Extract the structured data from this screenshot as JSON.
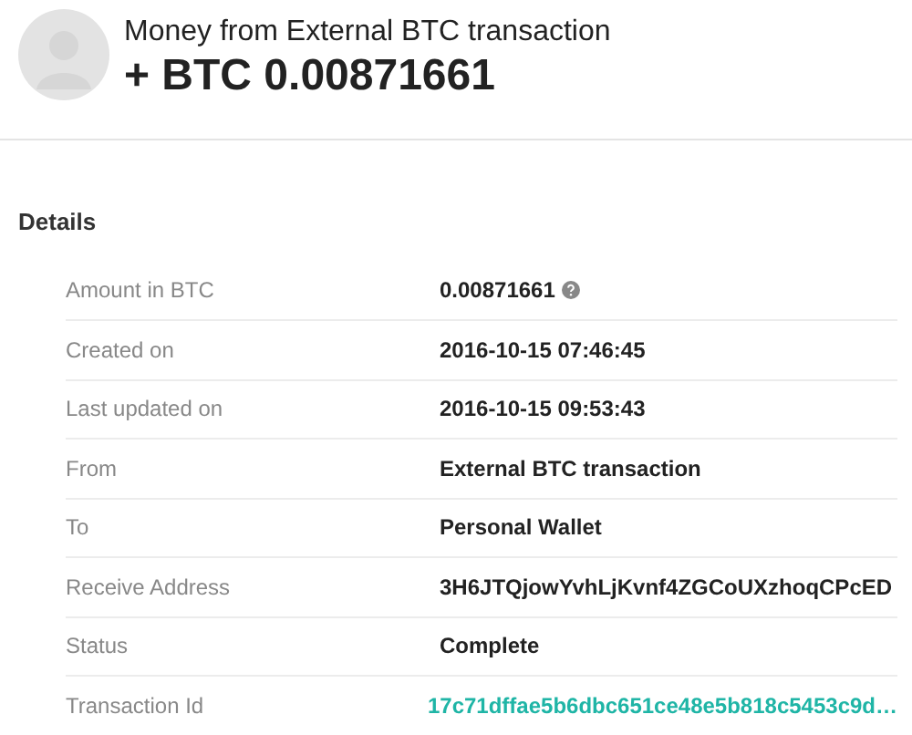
{
  "header": {
    "title": "Money from External BTC transaction",
    "amount": "+ BTC 0.00871661"
  },
  "details": {
    "heading": "Details",
    "rows": [
      {
        "label": "Amount in BTC",
        "value": "0.00871661",
        "kind": "text",
        "help": true
      },
      {
        "label": "Created on",
        "value": "2016-10-15 07:46:45",
        "kind": "text",
        "help": false
      },
      {
        "label": "Last updated on",
        "value": "2016-10-15 09:53:43",
        "kind": "text",
        "help": false
      },
      {
        "label": "From",
        "value": "External BTC transaction",
        "kind": "text",
        "help": false
      },
      {
        "label": "To",
        "value": "Personal Wallet",
        "kind": "text",
        "help": false
      },
      {
        "label": "Receive Address",
        "value": "3H6JTQjowYvhLjKvnf4ZGCoUXzhoqCPcED",
        "kind": "text",
        "help": false
      },
      {
        "label": "Status",
        "value": "Complete",
        "kind": "text",
        "help": false
      },
      {
        "label": "Transaction Id",
        "value": "17c71dffae5b6dbc651ce48e5b818c5453c9d…",
        "kind": "link",
        "help": false
      }
    ]
  }
}
